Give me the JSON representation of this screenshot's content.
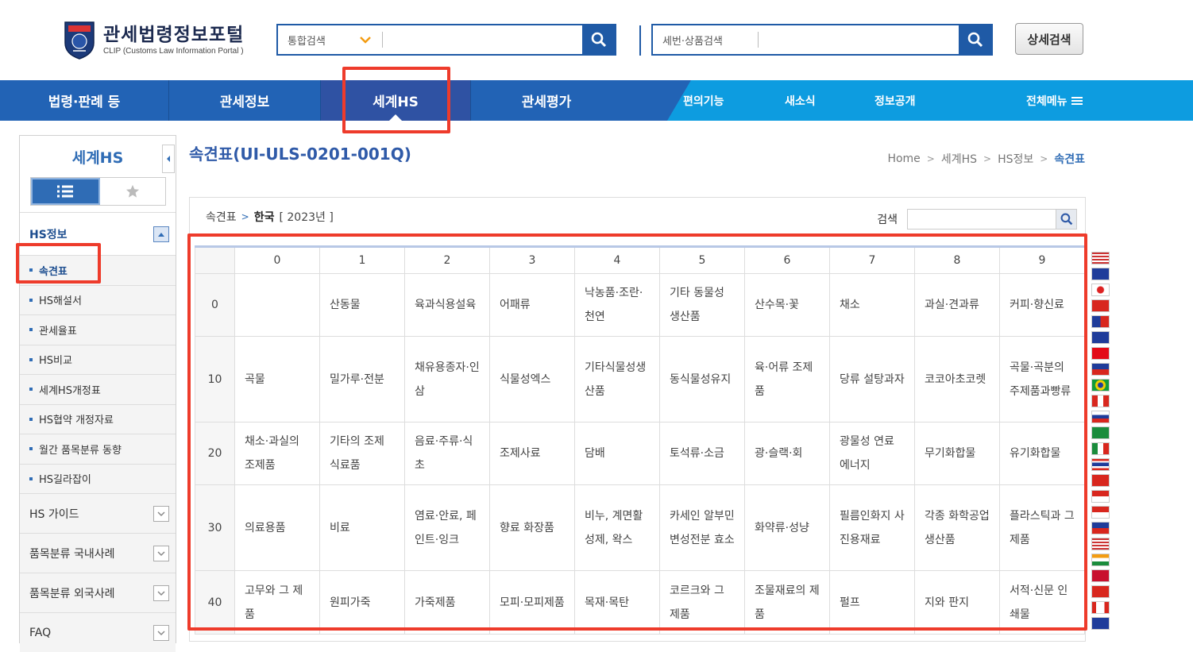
{
  "header": {
    "logo_title": "관세법령정보포털",
    "logo_sub": "CLIP (Customs Law Information Portal )",
    "search1_select": "통합검색",
    "search2_label": "세번·상품검색",
    "advanced_label": "상세검색"
  },
  "nav": {
    "main": [
      "법령·판례 등",
      "관세정보",
      "세계HS",
      "관세평가"
    ],
    "sub": [
      "편의기능",
      "새소식",
      "정보공개"
    ],
    "all_menu": "전체메뉴"
  },
  "sidebar": {
    "title": "세계HS",
    "active_category": "HS정보",
    "sub_items": [
      "속견표",
      "HS해설서",
      "관세율표",
      "HS비교",
      "세계HS개정표",
      "HS협약 개정자료",
      "월간 품목분류 동향",
      "HS길라잡이"
    ],
    "categories": [
      "HS 가이드",
      "품목분류 국내사례",
      "품목분류 외국사례",
      "FAQ"
    ]
  },
  "content": {
    "title": "속견표(UI-ULS-0201-001Q)",
    "breadcrumb": [
      "Home",
      "세계HS",
      "HS정보",
      "속견표"
    ],
    "path_root": "속견표",
    "path_country": "한국",
    "path_year": "[ 2023년 ]",
    "search_label": "검색"
  },
  "table": {
    "columns": [
      "0",
      "1",
      "2",
      "3",
      "4",
      "5",
      "6",
      "7",
      "8",
      "9"
    ],
    "rows": [
      {
        "head": "0",
        "cells": [
          "",
          "산동물",
          "육과식용설육",
          "어패류",
          "낙농품·조란·천연",
          "기타 동물성 생산품",
          "산수목·꽃",
          "채소",
          "과실·견과류",
          "커피·향신료"
        ]
      },
      {
        "head": "10",
        "cells": [
          "곡물",
          "밀가루·전분",
          "채유용종자·인삼",
          "식물성엑스",
          "기타식물성생산품",
          "동식물성유지",
          "육·어류 조제품",
          "당류 설탕과자",
          "코코아초코렛",
          "곡물·곡분의 주제품과빵류"
        ]
      },
      {
        "head": "20",
        "cells": [
          "채소·과실의 조제품",
          "기타의 조제 식료품",
          "음료·주류·식초",
          "조제사료",
          "담배",
          "토석류·소금",
          "광·슬랙·회",
          "광물성 연료 에너지",
          "무기화합물",
          "유기화합물"
        ]
      },
      {
        "head": "30",
        "cells": [
          "의료용품",
          "비료",
          "염료·안료, 페인트·잉크",
          "향료 화장품",
          "비누, 계면활성제, 왁스",
          "카세인 알부민 변성전분 효소",
          "화약류·성냥",
          "필름인화지 사진용재료",
          "각종 화학공업 생산품",
          "플라스틱과 그제품"
        ]
      },
      {
        "head": "40",
        "cells": [
          "고무와 그 제품",
          "원피가죽",
          "가죽제품",
          "모피·모피제품",
          "목재·목탄",
          "코르크와 그 제품",
          "조물재료의 제품",
          "펄프",
          "지와 판지",
          "서적·신문 인쇄물"
        ]
      }
    ]
  },
  "colors": {
    "nav_blue": "#2263b5",
    "nav_light": "#0d9ce0",
    "accent": "#2f6cb5",
    "highlight": "#ee3b2b"
  }
}
